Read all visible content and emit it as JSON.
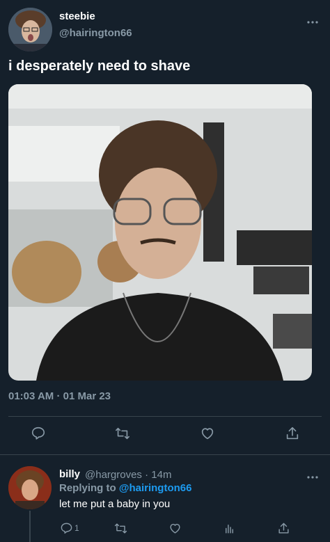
{
  "tweet": {
    "author_name": "steebie",
    "author_handle": "@hairington66",
    "text": "i desperately need to shave",
    "timestamp": "01:03 AM · 01 Mar 23",
    "actions": [
      "reply-icon",
      "retweet-icon",
      "like-icon",
      "share-icon"
    ]
  },
  "reply": {
    "author_name": "billy",
    "author_handle": "@hargroves · 14m",
    "replying_prefix": "Replying to",
    "replying_to": "@hairington66",
    "text": "let me put a baby in you",
    "reply_count": "1",
    "actions": [
      "reply-icon",
      "retweet-icon",
      "like-icon",
      "analytics-icon",
      "share-icon"
    ]
  },
  "colors": {
    "background": "#15202b",
    "secondary_text": "#8899a6",
    "accent": "#1d9bf0",
    "divider": "#38444d"
  }
}
